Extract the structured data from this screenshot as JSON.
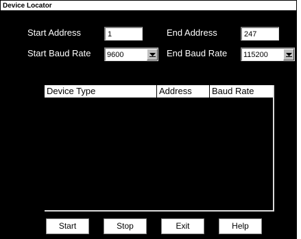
{
  "window": {
    "title": "Device Locator"
  },
  "form": {
    "start_address_label": "Start Address",
    "start_address_value": "1",
    "end_address_label": "End Address",
    "end_address_value": "247",
    "start_baud_label": "Start Baud Rate",
    "start_baud_value": "9600",
    "end_baud_label": "End Baud Rate",
    "end_baud_value": "115200"
  },
  "table": {
    "columns": [
      "Device Type",
      "Address",
      "Baud Rate"
    ],
    "rows": []
  },
  "buttons": {
    "start": "Start",
    "stop": "Stop",
    "exit": "Exit",
    "help": "Help"
  },
  "icons": {
    "dropdown": "chevron-down-icon"
  },
  "colors": {
    "background": "#000000",
    "field": "#ffffff",
    "text_on_bg": "#ffffff"
  }
}
